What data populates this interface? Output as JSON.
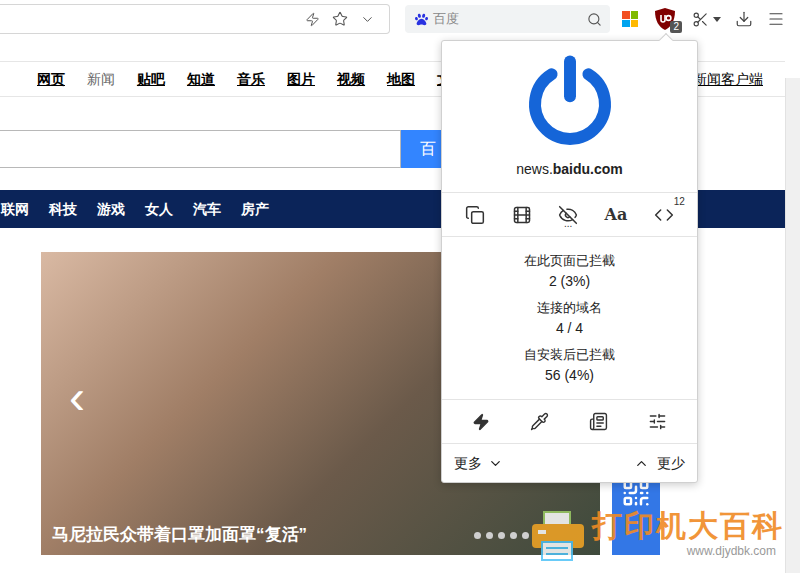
{
  "toolbar": {
    "search": {
      "placeholder": "百度"
    },
    "extension_badge": "2"
  },
  "page": {
    "nav_links": [
      {
        "label": "网页",
        "selected": false
      },
      {
        "label": "新闻",
        "selected": true
      },
      {
        "label": "贴吧",
        "selected": false
      },
      {
        "label": "知道",
        "selected": false
      },
      {
        "label": "音乐",
        "selected": false
      },
      {
        "label": "图片",
        "selected": false
      },
      {
        "label": "视频",
        "selected": false
      },
      {
        "label": "地图",
        "selected": false
      },
      {
        "label": "文",
        "selected": false
      }
    ],
    "client_link": "新闻客户端",
    "search_button": "百",
    "category_bar": [
      "联网",
      "科技",
      "游戏",
      "女人",
      "汽车",
      "房产"
    ],
    "carousel": {
      "prev": "‹",
      "caption": "马尼拉民众带着口罩加面罩“复活”",
      "dots": [
        {
          "selected": false
        },
        {
          "selected": false
        },
        {
          "selected": false
        },
        {
          "selected": false
        },
        {
          "selected": false
        }
      ]
    }
  },
  "popup": {
    "enabled": true,
    "domain_prefix": "news.",
    "domain": "baidu.com",
    "fonts_icon": "Aa",
    "script_count": "12",
    "more_mark": "...",
    "stats": [
      {
        "label": "在此页面已拦截",
        "value": "2 (3%)"
      },
      {
        "label": "连接的域名",
        "value": "4 / 4"
      },
      {
        "label": "自安装后已拦截",
        "value": "56 (4%)"
      }
    ],
    "footer": {
      "more": "更多",
      "less": "更少"
    }
  },
  "watermark": {
    "title": "打印机大百科",
    "url": "www.djydbk.com"
  }
}
